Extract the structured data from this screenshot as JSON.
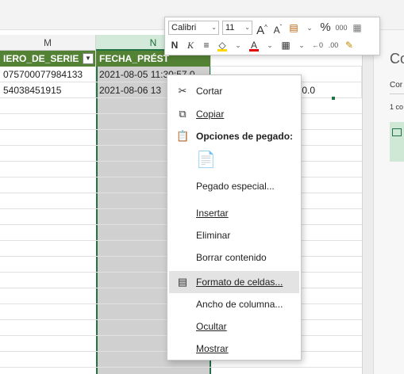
{
  "columns": {
    "m": "M",
    "n": "N"
  },
  "table": {
    "headers": {
      "m": "IERO_DE_SERIE",
      "n": "FECHA_PRÉST"
    },
    "rows": [
      {
        "m": "075700077984133",
        "n": "2021-08-05 11:30:57.0",
        "o": ""
      },
      {
        "m": "54038451915",
        "n": "2021-08-06 13",
        "o": "0.0"
      }
    ]
  },
  "mini_toolbar": {
    "font": "Calibri",
    "size": "11",
    "grow_font": "A",
    "shrink_font": "A",
    "bold": "N",
    "italic": "K",
    "font_color_letter": "A",
    "percent": "%",
    "thousands": "000",
    "colors": {
      "fill": "#ffd700",
      "font": "#e00000"
    }
  },
  "context_menu": {
    "cut": "Cortar",
    "copy": "Copiar",
    "paste_options": "Opciones de pegado:",
    "paste_special": "Pegado especial...",
    "insert": "Insertar",
    "delete": "Eliminar",
    "clear": "Borrar contenido",
    "format_cells": "Formato de celdas...",
    "column_width": "Ancho de columna...",
    "hide": "Ocultar",
    "show": "Mostrar"
  },
  "right_pane": {
    "title": "Co",
    "tab": "Cor",
    "count": "1 co"
  },
  "theme": {
    "accent": "#217346",
    "header_fill": "#548235",
    "selection": "#d0d0d0"
  }
}
